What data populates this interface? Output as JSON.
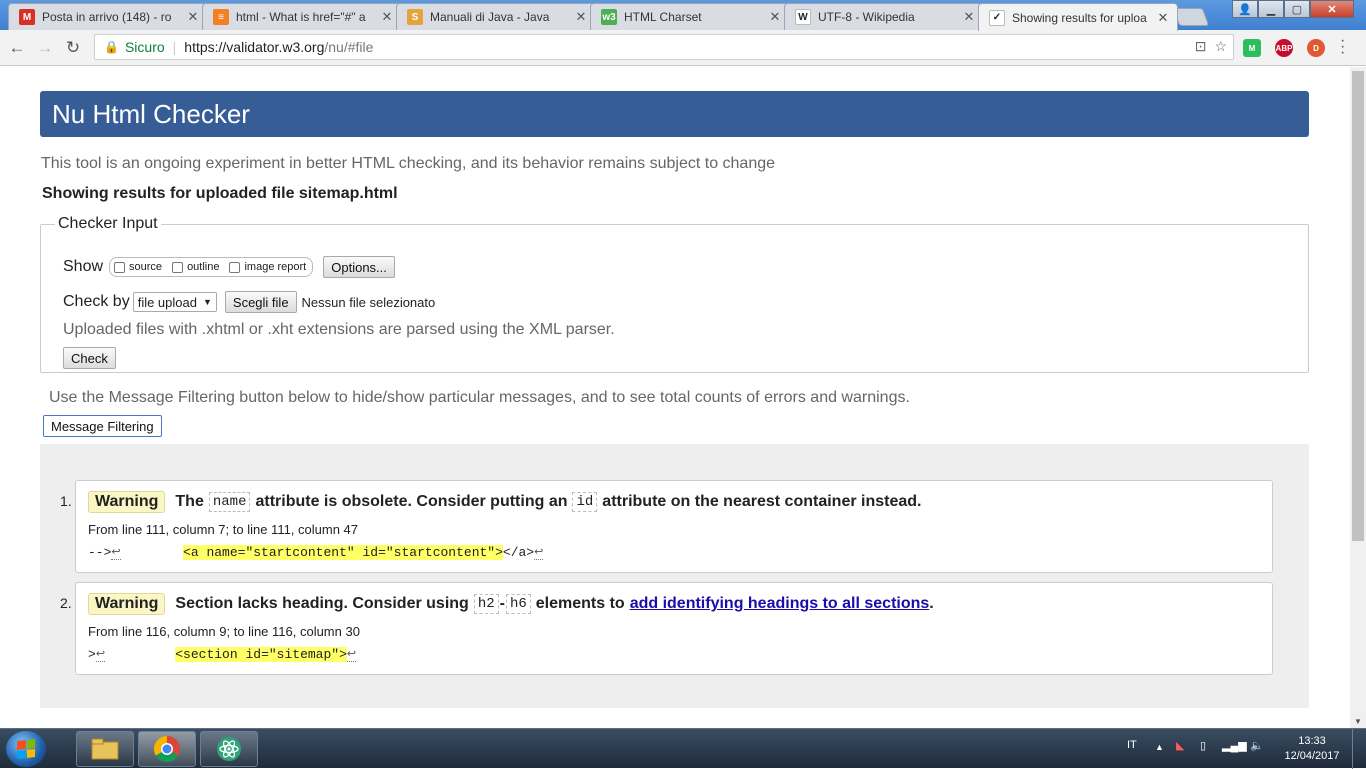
{
  "browser": {
    "tabs": [
      {
        "title": "Posta in arrivo (148) - ro",
        "icon": "gmail-icon",
        "color": "#d93025",
        "glyph": "M",
        "active": false
      },
      {
        "title": "html - What is href=\"#\" a",
        "icon": "stackoverflow-icon",
        "color": "#f48024",
        "glyph": "≡",
        "active": false
      },
      {
        "title": "Manuali di Java - Java",
        "icon": "manuali-icon",
        "color": "#e6a23c",
        "glyph": "S",
        "active": false
      },
      {
        "title": "HTML Charset",
        "icon": "w3schools-icon",
        "color": "#4caf50",
        "glyph": "w3",
        "active": false
      },
      {
        "title": "UTF-8 - Wikipedia",
        "icon": "wikipedia-icon",
        "color": "#ffffff",
        "glyph": "W",
        "active": false
      },
      {
        "title": "Showing results for uploa",
        "icon": "w3c-validator-icon",
        "color": "#ffffff",
        "glyph": "✓",
        "active": true
      }
    ],
    "close_glyph": "✕",
    "secure_label": "Sicuro",
    "url_host": "https://validator.w3.org",
    "url_path": "/nu/#file",
    "extensions": [
      {
        "name": "evernote-extension-icon",
        "label": "M",
        "color": "#2dbe60"
      },
      {
        "name": "adblock-plus-icon",
        "label": "ABP",
        "color": "#c70d2c"
      },
      {
        "name": "duckduckgo-icon",
        "label": "D",
        "color": "#de5833"
      }
    ]
  },
  "page": {
    "header_title": "Nu Html Checker",
    "tagline": "This tool is an ongoing experiment in better HTML checking, and its behavior remains subject to change",
    "results_title": "Showing results for uploaded file sitemap.html",
    "checker_input": {
      "legend": "Checker Input",
      "show_label": "Show",
      "show_options": [
        "source",
        "outline",
        "image report"
      ],
      "options_button": "Options...",
      "check_by_label": "Check by",
      "check_by_value": "file upload",
      "choose_file_button": "Scegli file",
      "no_file_text": "Nessun file selezionato",
      "xml_hint": "Uploaded files with .xhtml or .xht extensions are parsed using the XML parser.",
      "check_button": "Check"
    },
    "filter_note": "Use the Message Filtering button below to hide/show particular messages, and to see total counts of errors and warnings.",
    "filter_button": "Message Filtering",
    "messages": [
      {
        "number": "1.",
        "type": "Warning",
        "text_a": "The",
        "code_a": "name",
        "text_b": "attribute is obsolete. Consider putting an",
        "code_b": "id",
        "text_c": "attribute on the nearest container instead.",
        "location": "From line 111, column 7; to line 111, column 47",
        "extract_before": "-->",
        "extract_highlight": "<a name=\"startcontent\" id=\"startcontent\">",
        "extract_after": "</a>"
      },
      {
        "number": "2.",
        "type": "Warning",
        "text_a": "Section lacks heading. Consider using",
        "code_a": "h2",
        "dash": "-",
        "code_b": "h6",
        "text_b": "elements to",
        "link_text": "add identifying headings to all sections",
        "period": ".",
        "location": "From line 116, column 9; to line 116, column 30",
        "extract_before": ">",
        "extract_highlight": "<section id=\"sitemap\">",
        "extract_after": ""
      }
    ],
    "return_glyph": "↩"
  },
  "taskbar": {
    "language": "IT",
    "time": "13:33",
    "date": "12/04/2017"
  }
}
